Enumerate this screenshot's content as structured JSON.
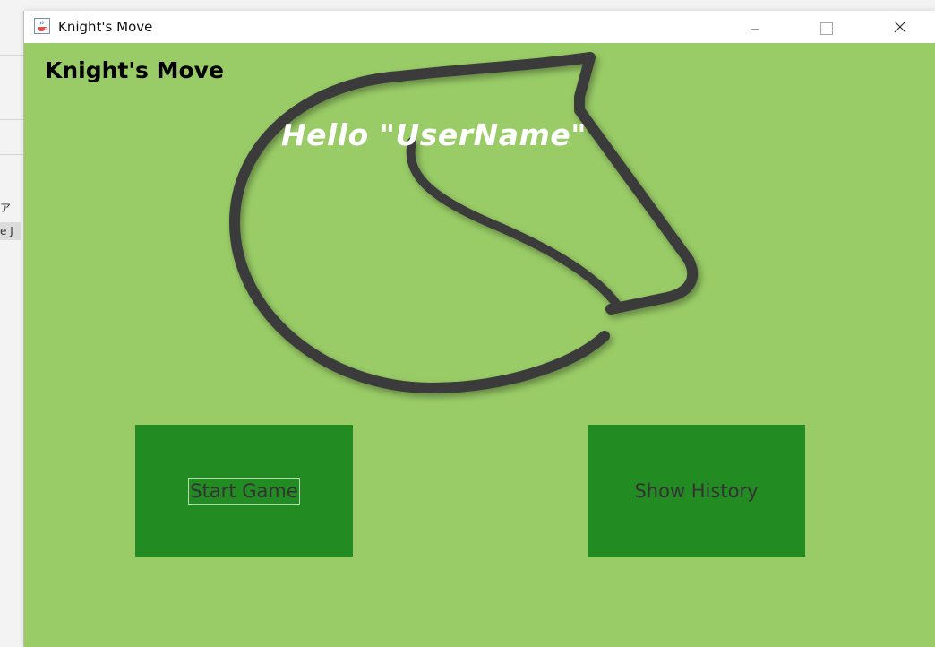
{
  "window": {
    "title": "Knight's Move",
    "app_icon": "java-cup-icon",
    "controls": [
      "minimize-icon",
      "maximize-icon",
      "close-icon"
    ]
  },
  "background_app": {
    "fragments": [
      "ア",
      "e J"
    ]
  },
  "content": {
    "heading": "Knight's Move",
    "greeting": "Hello \"UserName\"",
    "logo": "knight-horse-logo",
    "background_color": "#99cc66",
    "button_color": "#228b22"
  },
  "buttons": {
    "start_game": "Start Game",
    "show_history": "Show History"
  }
}
